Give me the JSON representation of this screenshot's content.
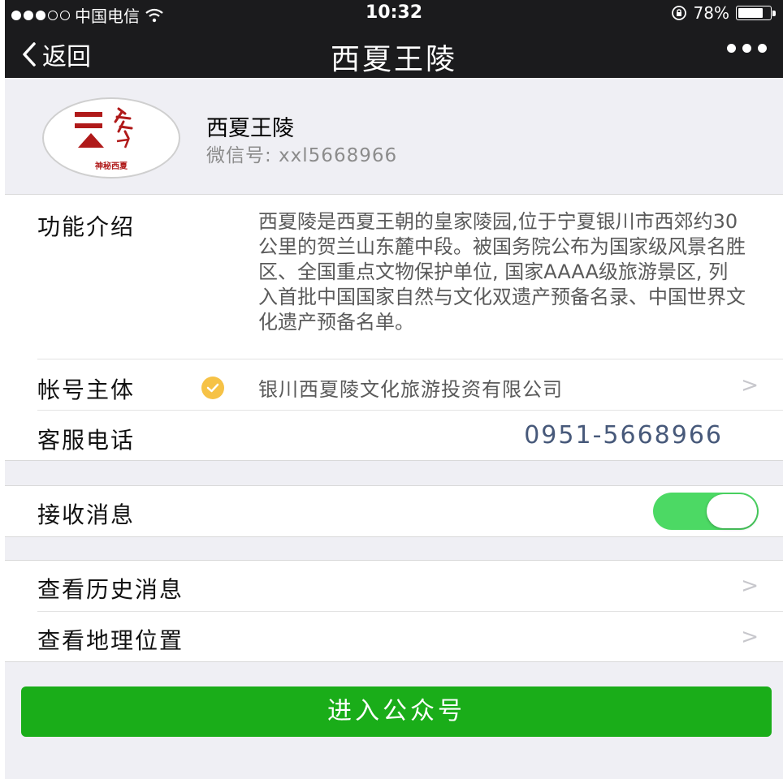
{
  "status_bar": {
    "carrier": "中国电信",
    "time": "10:32",
    "battery_text": "78%",
    "battery_level": 0.78
  },
  "nav": {
    "back_label": "返回",
    "title": "西夏王陵"
  },
  "profile": {
    "avatar_caption": "神秘西夏",
    "name": "西夏王陵",
    "wechat_id": "微信号: xxl5668966"
  },
  "info": {
    "intro_label": "功能介绍",
    "intro_text": "西夏陵是西夏王朝的皇家陵园,位于宁夏银川市西郊约30公里的贺兰山东麓中段。被国务院公布为国家级风景名胜区、全国重点文物保护单位, 国家AAAA级旅游景区, 列入首批中国国家自然与文化双遗产预备名录、中国世界文化遗产预备名单。",
    "entity_label": "帐号主体",
    "entity_value": "银川西夏陵文化旅游投资有限公司",
    "phone_label": "客服电话",
    "phone_value": "0951-5668966"
  },
  "receive": {
    "label": "接收消息",
    "enabled": true
  },
  "actions": {
    "history_label": "查看历史消息",
    "location_label": "查看地理位置"
  },
  "enter_button": "进入公众号",
  "colors": {
    "nav_bg": "#1b1b1d",
    "accent_green": "#1aad19",
    "toggle_green": "#4cd964",
    "phone_blue": "#47597a",
    "verify_yellow": "#f6c246"
  },
  "icons": [
    "wifi-icon",
    "lock-rotation-icon",
    "battery-icon",
    "back-chevron-icon",
    "more-icon",
    "verified-icon",
    "chevron-right-icon"
  ]
}
